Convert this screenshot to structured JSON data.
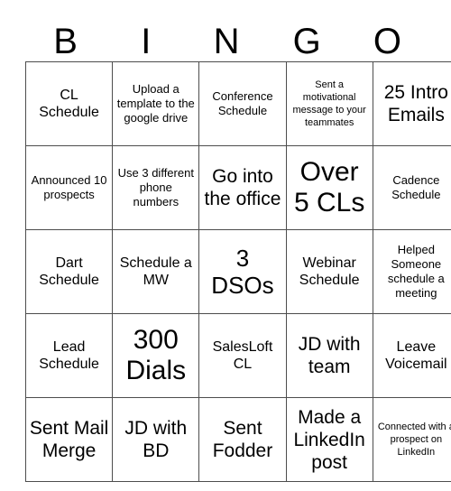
{
  "header": {
    "letters": [
      "B",
      "I",
      "N",
      "G",
      "O"
    ]
  },
  "grid": {
    "rows": [
      [
        {
          "text": "CL Schedule",
          "size": "sz-md"
        },
        {
          "text": "Upload a template to the google drive",
          "size": "sz-sm"
        },
        {
          "text": "Conference Schedule",
          "size": "sz-sm"
        },
        {
          "text": "Sent a motivational message to your teammates",
          "size": "sz-xs"
        },
        {
          "text": "25 Intro Emails",
          "size": "sz-lg"
        }
      ],
      [
        {
          "text": "Announced 10 prospects",
          "size": "sz-sm"
        },
        {
          "text": "Use 3 different phone numbers",
          "size": "sz-sm"
        },
        {
          "text": "Go into the office",
          "size": "sz-lg"
        },
        {
          "text": "Over 5 CLs",
          "size": "sz-xxl"
        },
        {
          "text": "Cadence Schedule",
          "size": "sz-sm"
        }
      ],
      [
        {
          "text": "Dart Schedule",
          "size": "sz-md"
        },
        {
          "text": "Schedule a MW",
          "size": "sz-md"
        },
        {
          "text": "3 DSOs",
          "size": "sz-xl"
        },
        {
          "text": "Webinar Schedule",
          "size": "sz-md"
        },
        {
          "text": "Helped Someone schedule a meeting",
          "size": "sz-sm"
        }
      ],
      [
        {
          "text": "Lead Schedule",
          "size": "sz-md"
        },
        {
          "text": "300 Dials",
          "size": "sz-xxl"
        },
        {
          "text": "SalesLoft CL",
          "size": "sz-md"
        },
        {
          "text": "JD with team",
          "size": "sz-lg"
        },
        {
          "text": "Leave Voicemail",
          "size": "sz-md"
        }
      ],
      [
        {
          "text": "Sent Mail Merge",
          "size": "sz-lg"
        },
        {
          "text": "JD with BD",
          "size": "sz-lg"
        },
        {
          "text": "Sent Fodder",
          "size": "sz-lg"
        },
        {
          "text": "Made a LinkedIn post",
          "size": "sz-lg"
        },
        {
          "text": "Connected with a prospect on LinkedIn",
          "size": "sz-xs"
        }
      ]
    ]
  },
  "colors": {
    "background": "#ffffff",
    "text": "#000000",
    "border": "#4d4d4d"
  }
}
